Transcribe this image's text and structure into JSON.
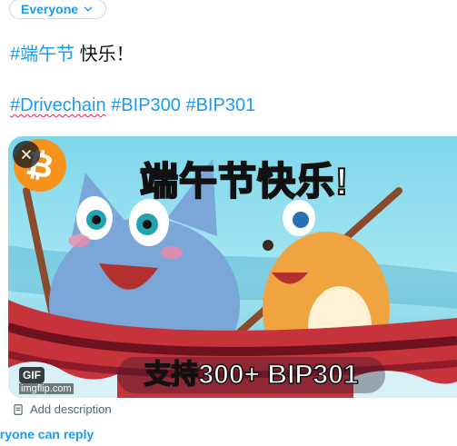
{
  "audience": {
    "label": "Everyone"
  },
  "tweet": {
    "line1_tag": "#端午节",
    "line1_text": " 快乐！",
    "hashtags": [
      "#Drivechain",
      "#BIP300",
      "#BIP301"
    ]
  },
  "media": {
    "caption_top": "端午节快乐!",
    "caption_bottom": "支持300+ BIP301",
    "bitcoin_symbol": "₿",
    "gif_badge": "GIF",
    "attribution": "imgflip.com"
  },
  "add_description": "Add description",
  "reply_setting": "eryone can reply",
  "colors": {
    "accent": "#1d9bf0",
    "bitcoin": "#f7931a"
  }
}
